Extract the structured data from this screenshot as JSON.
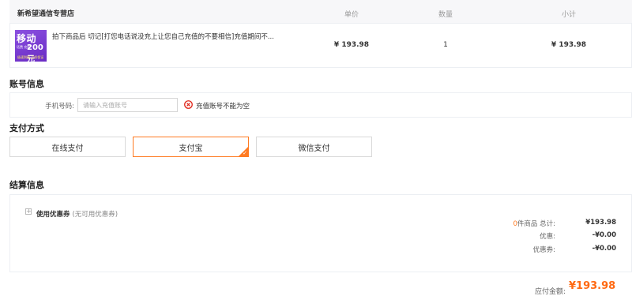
{
  "order": {
    "shop_name": "新希望通信专营店",
    "headers": {
      "price": "单价",
      "qty": "数量",
      "subtotal": "小计"
    },
    "item": {
      "thumb": {
        "title": "移动",
        "line1": "话费\n充值",
        "amount": "200元",
        "footer": "极速到账 品质保证"
      },
      "title": "拍下商品后 切记[打您电话说没充上让您自己充值的不要相信]充值期间不...",
      "price": "¥ 193.98",
      "qty": "1",
      "subtotal": "¥ 193.98"
    }
  },
  "account": {
    "title": "账号信息",
    "phone_label": "手机号码:",
    "phone_value": "",
    "phone_placeholder": "请输入充值账号",
    "error": "充值账号不能为空"
  },
  "payment": {
    "title": "支付方式",
    "options": [
      "在线支付",
      "支付宝",
      "微信支付"
    ],
    "selected": "支付宝"
  },
  "settlement": {
    "title": "结算信息",
    "coupon_label": "使用优惠券",
    "coupon_note": "(无可用优惠券)",
    "item_count": "0",
    "item_count_suffix": "件商品 总计:",
    "total": "¥193.98",
    "discount_label": "优惠:",
    "discount": "-¥0.00",
    "coupon_discount_label": "优惠券:",
    "coupon_discount": "-¥0.00",
    "due_label": "应付金额:",
    "due": "¥193.98"
  },
  "colors": {
    "accent": "#ff7b22",
    "error": "#e0261a",
    "thumb": "#7b3fd8"
  }
}
